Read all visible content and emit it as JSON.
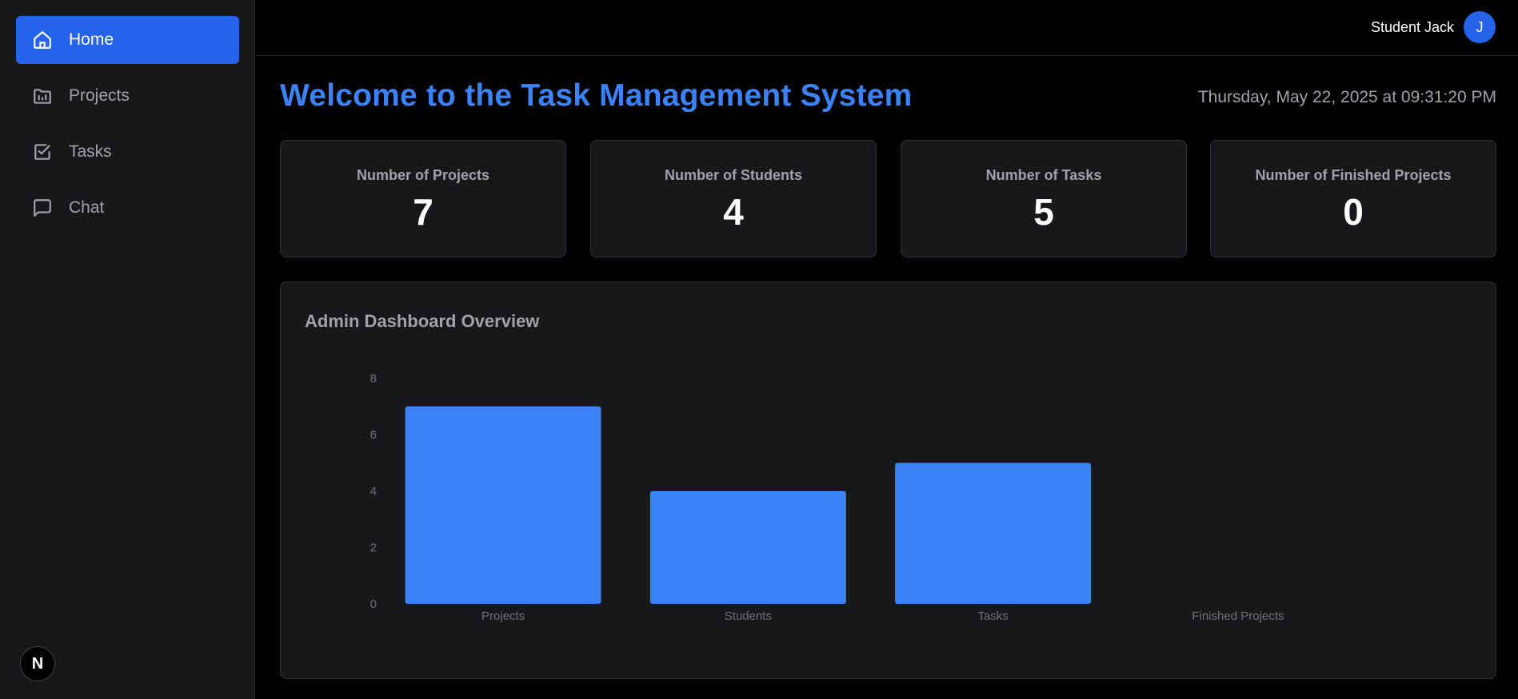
{
  "sidebar": {
    "items": [
      {
        "label": "Home",
        "icon": "home-icon",
        "active": true
      },
      {
        "label": "Projects",
        "icon": "folder-chart-icon",
        "active": false
      },
      {
        "label": "Tasks",
        "icon": "checkbox-icon",
        "active": false
      },
      {
        "label": "Chat",
        "icon": "chat-bubble-icon",
        "active": false
      }
    ],
    "badge": "N"
  },
  "header": {
    "user_name": "Student Jack",
    "avatar_initial": "J"
  },
  "main": {
    "title": "Welcome to the Task Management System",
    "datetime": "Thursday, May 22, 2025 at 09:31:20 PM",
    "stats": [
      {
        "label": "Number of Projects",
        "value": "7"
      },
      {
        "label": "Number of Students",
        "value": "4"
      },
      {
        "label": "Number of Tasks",
        "value": "5"
      },
      {
        "label": "Number of Finished Projects",
        "value": "0"
      }
    ],
    "chart_title": "Admin Dashboard Overview"
  },
  "colors": {
    "accent": "#2563eb",
    "bar": "#3b82f6",
    "title": "#3b82f6"
  },
  "chart_data": {
    "type": "bar",
    "title": "Admin Dashboard Overview",
    "categories": [
      "Projects",
      "Students",
      "Tasks",
      "Finished Projects"
    ],
    "values": [
      7,
      4,
      5,
      0
    ],
    "yticks": [
      0,
      2,
      4,
      6,
      8
    ],
    "ylim": [
      0,
      8
    ],
    "xlabel": "",
    "ylabel": "",
    "grid": false,
    "legend": "none"
  }
}
